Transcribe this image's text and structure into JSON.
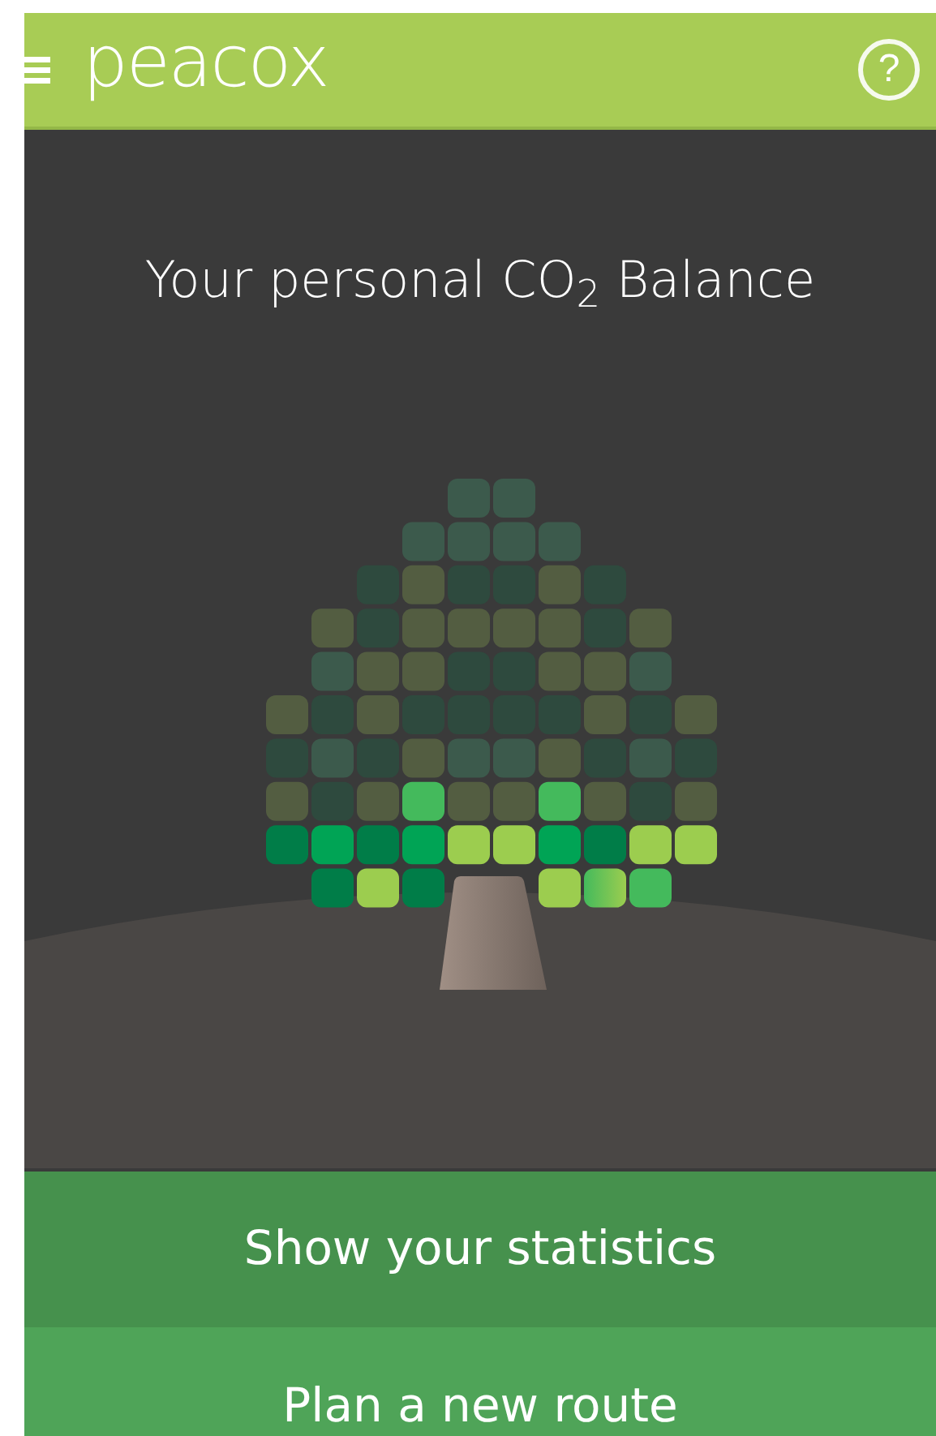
{
  "header": {
    "logo": "peacox",
    "help": "?"
  },
  "title": "Your personal CO$_{2}$ Balance",
  "buttons": [
    "Show your statistics",
    "Plan a new route"
  ]
}
